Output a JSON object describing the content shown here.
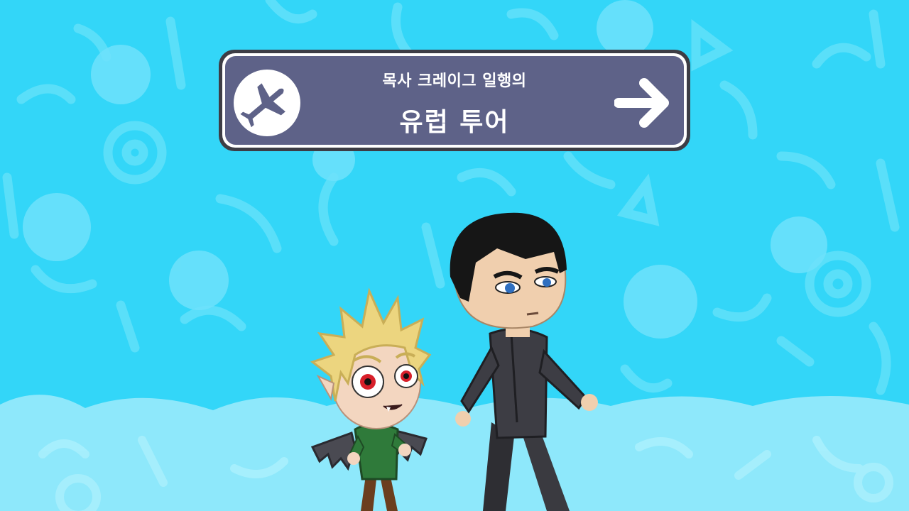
{
  "banner": {
    "subtitle": "목사 크레이그 일행의",
    "title": "유럽 투어",
    "left_icon": "airplane-icon",
    "right_icon": "arrow-right-icon"
  },
  "characters": [
    {
      "id": "blonde-vampire-kid"
    },
    {
      "id": "black-haired-man"
    }
  ],
  "colors": {
    "sky": "#33d6f8",
    "ground": "#8ee8fb",
    "banner_face": "#5e6288",
    "banner_border": "#3d3d45"
  }
}
